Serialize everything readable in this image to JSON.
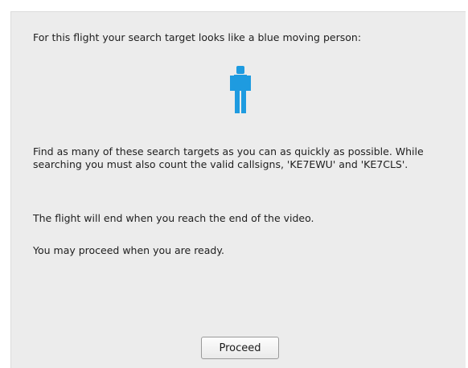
{
  "instructions": {
    "intro": "For this flight your search target looks like a blue moving person:",
    "paragraph1": "Find as many of these search targets as you can as quickly as possible. While searching you must also count the valid callsigns, 'KE7EWU' and 'KE7CLS'.",
    "paragraph2": "The flight will end when you reach the end of the video.",
    "paragraph3": "You may proceed when you are ready."
  },
  "target_icon": {
    "icon": "person-icon",
    "color": "#1e9be0"
  },
  "actions": {
    "proceed_label": "Proceed"
  }
}
